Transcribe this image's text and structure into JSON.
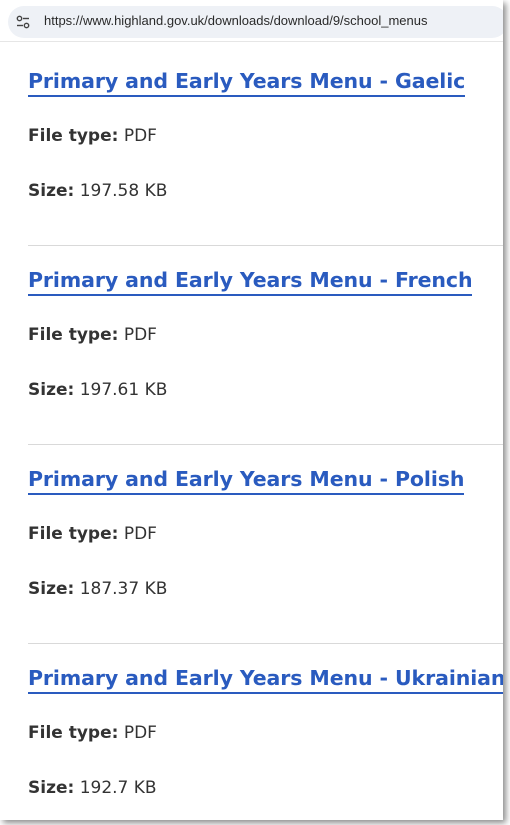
{
  "browser": {
    "url": "https://www.highland.gov.uk/downloads/download/9/school_menus"
  },
  "downloads": [
    {
      "title": "Primary and Early Years Menu - Gaelic",
      "file_type_label": "File type:",
      "file_type": "PDF",
      "size_label": "Size:",
      "size": "197.58 KB"
    },
    {
      "title": "Primary and Early Years Menu - French",
      "file_type_label": "File type:",
      "file_type": "PDF",
      "size_label": "Size:",
      "size": "197.61 KB"
    },
    {
      "title": "Primary and Early Years Menu - Polish",
      "file_type_label": "File type:",
      "file_type": "PDF",
      "size_label": "Size:",
      "size": "187.37 KB"
    },
    {
      "title": "Primary and Early Years Menu - Ukrainian",
      "file_type_label": "File type:",
      "file_type": "PDF",
      "size_label": "Size:",
      "size": "192.7 KB"
    }
  ],
  "colors": {
    "link": "#2a5bbf",
    "text": "#333333",
    "divider": "#d9d9d9"
  }
}
